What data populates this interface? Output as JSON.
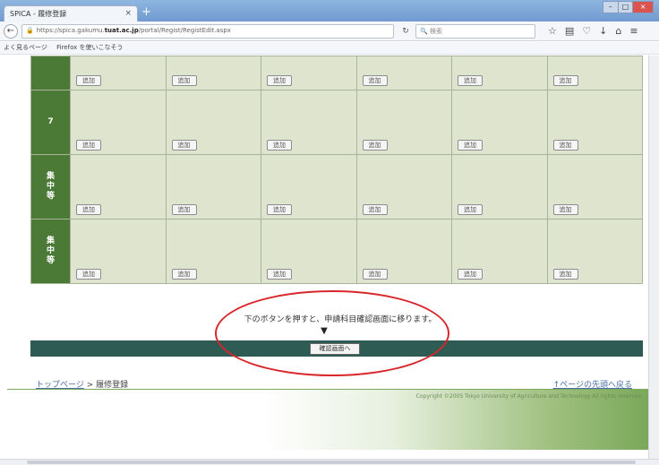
{
  "browser": {
    "tab_title": "SPICA - 履修登録",
    "tab_close": "×",
    "new_tab": "+",
    "url_prefix": "https://spica.gakumu.",
    "url_domain": "tuat.ac.jp",
    "url_suffix": "/portal/Regist/RegistEdit.aspx",
    "search_placeholder": "検索",
    "bookmarks": [
      "よく見るページ",
      "Firefox を使いこなそう"
    ],
    "window_buttons": [
      "–",
      "□",
      "×"
    ]
  },
  "grid": {
    "add_label": "追加",
    "rows": [
      {
        "label": "",
        "cells": 6
      },
      {
        "label": "7",
        "cells": 6
      },
      {
        "label": "集中等",
        "cells": 6
      },
      {
        "label": "集中等",
        "cells": 6
      }
    ]
  },
  "confirm": {
    "notice": "下のボタンを押すと、申請科目確認画面に移ります。",
    "arrow": "▼",
    "button_label": "確認画面へ"
  },
  "breadcrumb": {
    "home": "トップページ",
    "separator": " > ",
    "current": "履修登録"
  },
  "page_top_link": "↑ページの先頭へ戻る",
  "footer": {
    "copyright": "Copyright ©2005 Tokyo University of Agriculture and Technology All rights reserved."
  },
  "colors": {
    "header_green": "#4b7a37",
    "cell_bg": "#dfe4cf",
    "confirm_bar": "#2f5b55",
    "highlight_red": "#d9262b"
  }
}
